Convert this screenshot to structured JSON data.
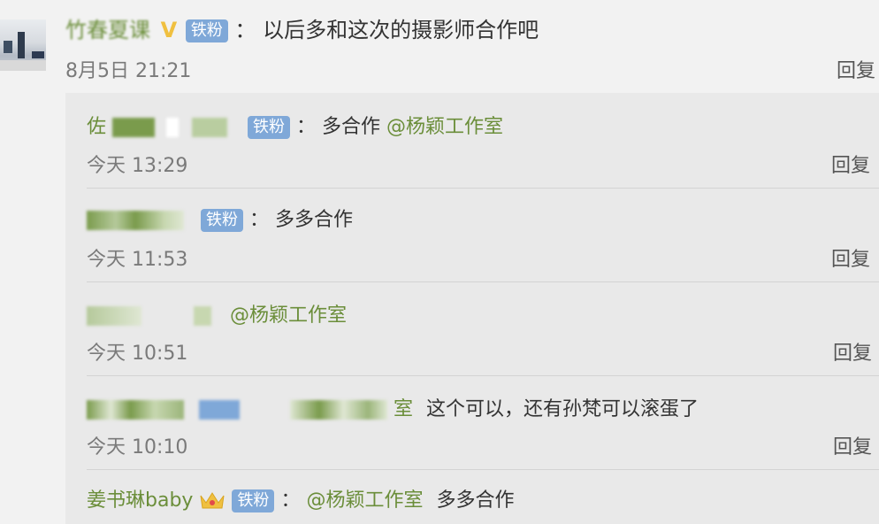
{
  "main_comment": {
    "author": "竹春夏课",
    "vip_mark": "V",
    "badge": "铁粉",
    "separator": "：",
    "text": "以后多和这次的摄影师合作吧",
    "time": "8月5日 21:21",
    "reply_label": "回复"
  },
  "replies": [
    {
      "author": "佐",
      "badge": "铁粉",
      "separator": "：",
      "text_prefix": "多合作",
      "mention": "@杨颖工作室",
      "text_suffix": "",
      "time": "今天 13:29",
      "reply_label": "回复"
    },
    {
      "author": "",
      "badge": "铁粉",
      "separator": "：",
      "text_prefix": "多多合作",
      "mention": "",
      "text_suffix": "",
      "time": "今天 11:53",
      "reply_label": "回复"
    },
    {
      "author": "",
      "badge": "",
      "separator": "",
      "text_prefix": "",
      "mention": "@杨颖工作室",
      "text_suffix": "",
      "time": "今天 10:51",
      "reply_label": "回复"
    },
    {
      "author": "",
      "badge": "",
      "separator": "",
      "text_prefix": "",
      "mention": "室",
      "text_suffix": "这个可以，还有孙梵可以滚蛋了",
      "time": "今天 10:10",
      "reply_label": "回复"
    },
    {
      "author": "姜书琳baby",
      "badge": "铁粉",
      "separator": "：",
      "text_prefix": "",
      "mention": "@杨颖工作室",
      "text_suffix": "多多合作",
      "time": "",
      "reply_label": ""
    }
  ],
  "colors": {
    "username": "#6b8e3a",
    "badge": "#7fa8d8",
    "vip": "#f0c040",
    "panel": "#e9e9e9"
  },
  "icons": [
    "vip-icon",
    "crown-icon"
  ]
}
